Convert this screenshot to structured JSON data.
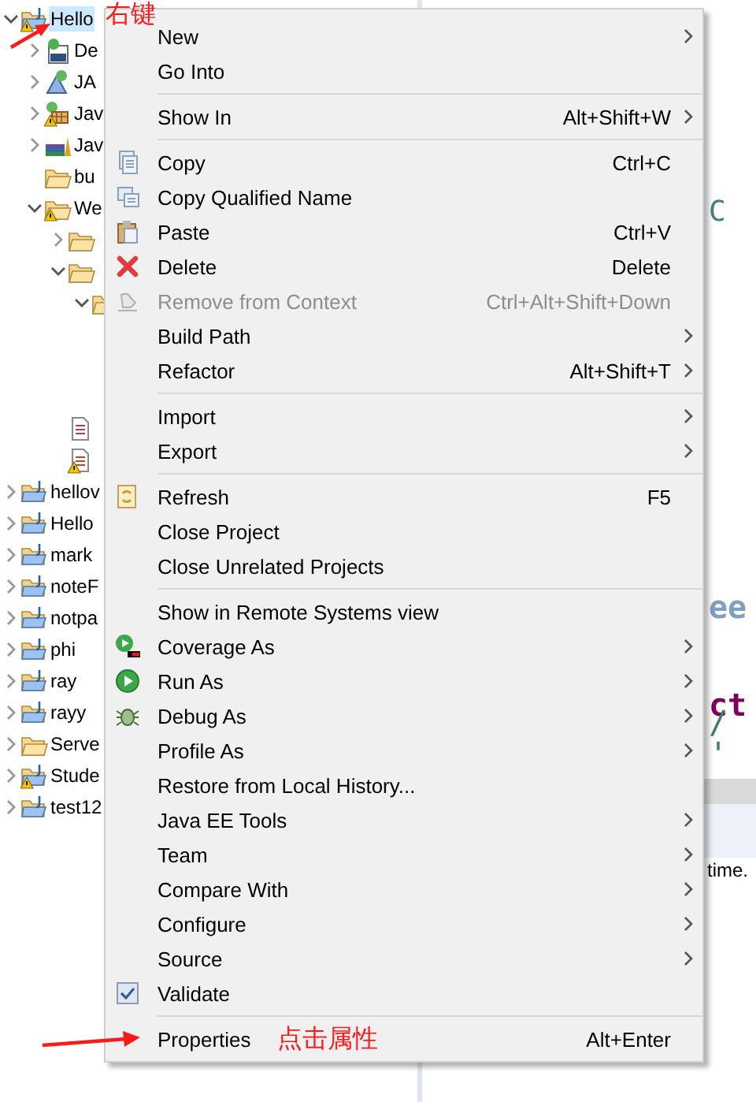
{
  "project_tree": [
    {
      "label": "Hello",
      "kind": "project",
      "warning": true,
      "selected": true,
      "expanded": true,
      "children": [
        {
          "label": "De",
          "kind": "descriptor",
          "warning": false,
          "selected": false,
          "expanded": false
        },
        {
          "label": "JA",
          "kind": "service",
          "warning": false,
          "selected": false,
          "expanded": false
        },
        {
          "label": "Jav",
          "kind": "resources",
          "warning": true,
          "selected": false,
          "expanded": false
        },
        {
          "label": "Jav",
          "kind": "library",
          "warning": false,
          "selected": false,
          "expanded": false
        },
        {
          "label": "bu",
          "kind": "folder",
          "warning": false,
          "selected": false
        },
        {
          "label": "We",
          "kind": "folder",
          "warning": true,
          "selected": false,
          "expanded": true,
          "children": [
            {
              "kind": "folder",
              "warning": false,
              "selected": false,
              "expanded": false
            },
            {
              "kind": "folder",
              "warning": false,
              "selected": false,
              "expanded": true,
              "children": [
                {
                  "warning": false,
                  "selected": false,
                  "expanded": true
                }
              ]
            },
            {
              "kind": "file",
              "warning": false,
              "selected": false
            },
            {
              "kind": "file",
              "warning": true,
              "selected": false
            }
          ]
        }
      ]
    },
    {
      "label": "hellov",
      "kind": "project",
      "warning": false,
      "selected": false,
      "expanded": false
    },
    {
      "label": "Hello",
      "kind": "project",
      "warning": false,
      "selected": false,
      "expanded": false
    },
    {
      "label": "mark",
      "kind": "project",
      "warning": false,
      "selected": false,
      "expanded": false
    },
    {
      "label": "noteF",
      "kind": "project",
      "warning": false,
      "selected": false,
      "expanded": false
    },
    {
      "label": "notpa",
      "kind": "project",
      "warning": false,
      "selected": false,
      "expanded": false
    },
    {
      "label": "phi",
      "kind": "project",
      "warning": false,
      "selected": false,
      "expanded": false
    },
    {
      "label": "ray",
      "kind": "project",
      "warning": false,
      "selected": false,
      "expanded": false
    },
    {
      "label": "rayy",
      "kind": "project",
      "warning": false,
      "selected": false,
      "expanded": false
    },
    {
      "label": "Serve",
      "kind": "folder",
      "warning": false,
      "selected": false,
      "expanded": false
    },
    {
      "label": "Stude",
      "kind": "project",
      "warning": true,
      "selected": false,
      "expanded": false
    },
    {
      "label": "test12",
      "kind": "project",
      "warning": false,
      "selected": false,
      "expanded": false
    }
  ],
  "editor": {
    "lines": [
      {
        "text": "C",
        "kind": "type"
      },
      {
        "text": "ee",
        "kind": "doc"
      },
      {
        "text": "ct",
        "kind": "keyword"
      },
      {
        "text": "/ '",
        "kind": "comment"
      }
    ],
    "console_text": "time."
  },
  "context_menu": [
    {
      "kind": "item",
      "label": "New",
      "submenu": true,
      "disabled": false
    },
    {
      "kind": "item",
      "label": "Go Into",
      "submenu": false,
      "disabled": false
    },
    {
      "kind": "separator"
    },
    {
      "kind": "item",
      "label": "Show In",
      "shortcut": "Alt+Shift+W",
      "submenu": true,
      "disabled": false
    },
    {
      "kind": "separator"
    },
    {
      "kind": "item",
      "label": "Copy",
      "shortcut": "Ctrl+C",
      "submenu": false,
      "disabled": false
    },
    {
      "kind": "item",
      "label": "Copy Qualified Name",
      "submenu": false,
      "disabled": false
    },
    {
      "kind": "item",
      "label": "Paste",
      "shortcut": "Ctrl+V",
      "submenu": false,
      "disabled": false
    },
    {
      "kind": "item",
      "label": "Delete",
      "shortcut": "Delete",
      "submenu": false,
      "disabled": false
    },
    {
      "kind": "item",
      "label": "Remove from Context",
      "shortcut": "Ctrl+Alt+Shift+Down",
      "submenu": false,
      "disabled": true
    },
    {
      "kind": "item",
      "label": "Build Path",
      "submenu": true,
      "disabled": false
    },
    {
      "kind": "item",
      "label": "Refactor",
      "shortcut": "Alt+Shift+T",
      "submenu": true,
      "disabled": false
    },
    {
      "kind": "separator"
    },
    {
      "kind": "item",
      "label": "Import",
      "submenu": true,
      "disabled": false
    },
    {
      "kind": "item",
      "label": "Export",
      "submenu": true,
      "disabled": false
    },
    {
      "kind": "separator"
    },
    {
      "kind": "item",
      "label": "Refresh",
      "shortcut": "F5",
      "submenu": false,
      "disabled": false
    },
    {
      "kind": "item",
      "label": "Close Project",
      "submenu": false,
      "disabled": false
    },
    {
      "kind": "item",
      "label": "Close Unrelated Projects",
      "submenu": false,
      "disabled": false
    },
    {
      "kind": "separator"
    },
    {
      "kind": "item",
      "label": "Show in Remote Systems view",
      "submenu": false,
      "disabled": false
    },
    {
      "kind": "item",
      "label": "Coverage As",
      "submenu": true,
      "disabled": false
    },
    {
      "kind": "item",
      "label": "Run As",
      "submenu": true,
      "disabled": false
    },
    {
      "kind": "item",
      "label": "Debug As",
      "submenu": true,
      "disabled": false
    },
    {
      "kind": "item",
      "label": "Profile As",
      "submenu": true,
      "disabled": false
    },
    {
      "kind": "item",
      "label": "Restore from Local History...",
      "submenu": false,
      "disabled": false
    },
    {
      "kind": "item",
      "label": "Java EE Tools",
      "submenu": true,
      "disabled": false
    },
    {
      "kind": "item",
      "label": "Team",
      "submenu": true,
      "disabled": false
    },
    {
      "kind": "item",
      "label": "Compare With",
      "submenu": true,
      "disabled": false
    },
    {
      "kind": "item",
      "label": "Configure",
      "submenu": true,
      "disabled": false
    },
    {
      "kind": "item",
      "label": "Source",
      "submenu": true,
      "disabled": false
    },
    {
      "kind": "item",
      "label": "Validate",
      "submenu": false,
      "disabled": false,
      "checked": true
    },
    {
      "kind": "separator"
    },
    {
      "kind": "item",
      "label": "Properties",
      "shortcut": "Alt+Enter",
      "submenu": false,
      "disabled": false
    }
  ],
  "annotations": [
    {
      "text": "右键"
    },
    {
      "text": "点击属性"
    }
  ]
}
